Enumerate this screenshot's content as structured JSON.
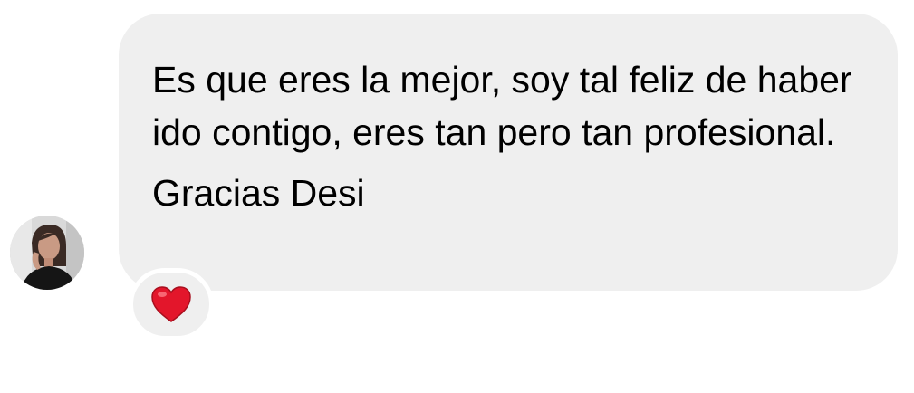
{
  "message": {
    "paragraphs": [
      "Es que eres la mejor, soy tal feliz de haber ido contigo, eres tan pero tan profesional.",
      "Gracias Desi"
    ],
    "reaction": "heart-emoji"
  },
  "colors": {
    "bubble_background": "#efefef",
    "page_background": "#ffffff",
    "text": "#000000",
    "heart": "#e3162b"
  },
  "sender": {
    "avatar": "profile-photo"
  }
}
